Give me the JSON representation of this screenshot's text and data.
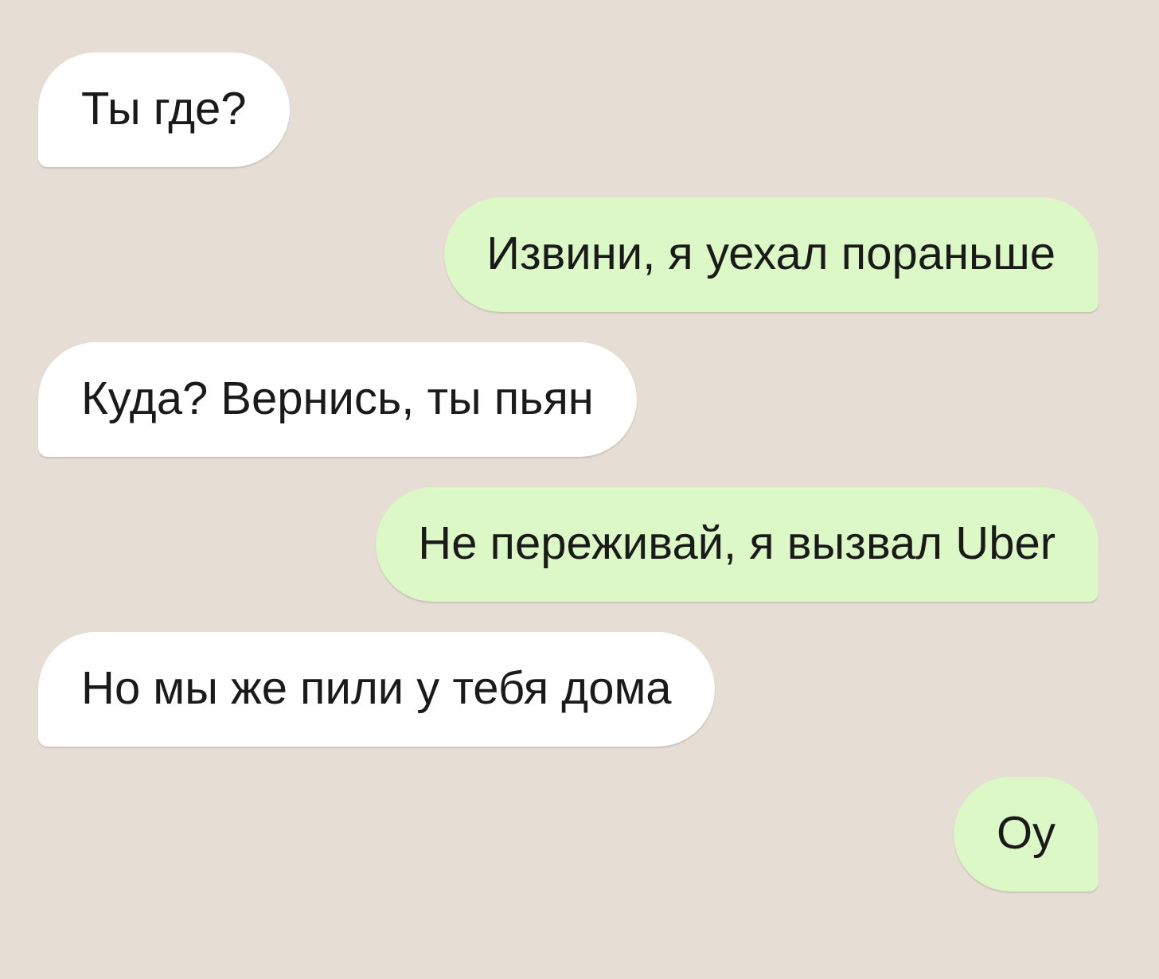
{
  "messages": [
    {
      "kind": "incoming",
      "text": "Ты где?"
    },
    {
      "kind": "outgoing",
      "text": "Извини, я уехал пораньше"
    },
    {
      "kind": "incoming",
      "text": "Куда? Вернись, ты пьян"
    },
    {
      "kind": "outgoing",
      "text": "Не переживай, я вызвал Uber"
    },
    {
      "kind": "incoming",
      "text": "Но мы же пили у тебя дома"
    },
    {
      "kind": "outgoing",
      "text": "Оу"
    }
  ]
}
